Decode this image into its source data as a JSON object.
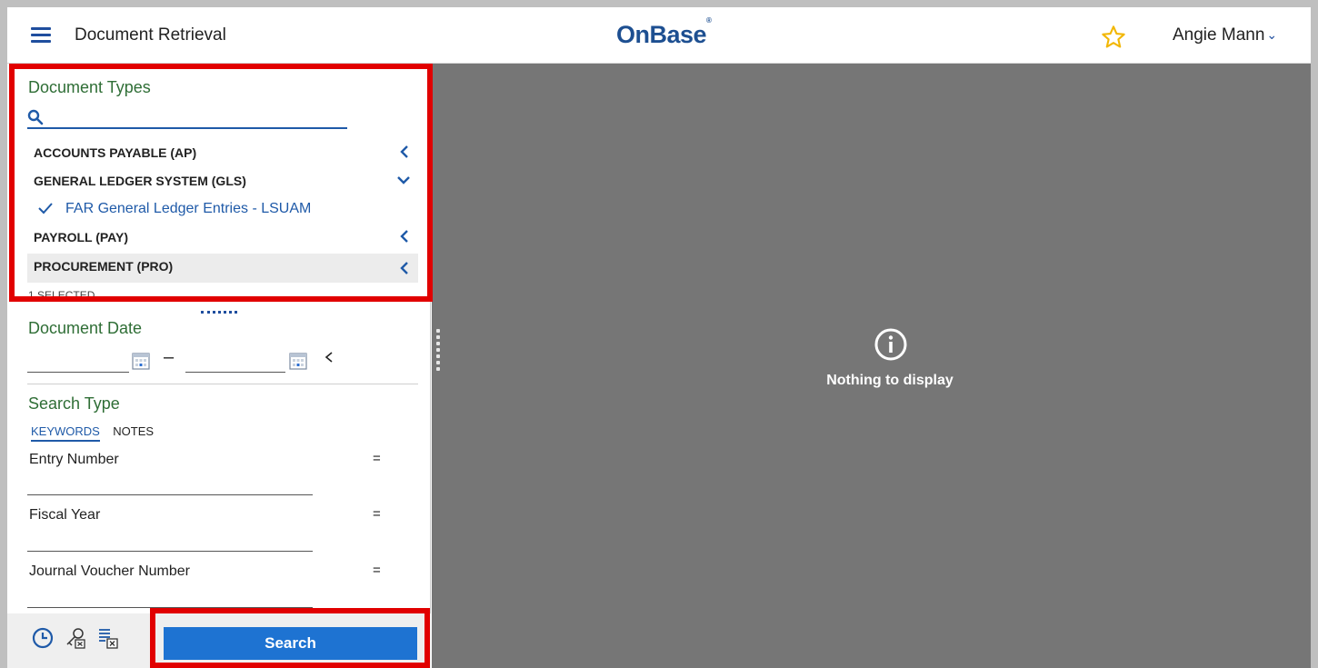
{
  "header": {
    "title": "Document Retrieval",
    "logo": "OnBase",
    "logo_mark": "®",
    "user_name": "Angie Mann"
  },
  "document_types": {
    "heading": "Document Types",
    "search_placeholder": "",
    "groups": [
      {
        "label": "ACCOUNTS PAYABLE (AP)",
        "state": "collapsed"
      },
      {
        "label": "GENERAL LEDGER SYSTEM (GLS)",
        "state": "expanded"
      },
      {
        "label": "PAYROLL (PAY)",
        "state": "collapsed"
      },
      {
        "label": "PROCUREMENT (PRO)",
        "state": "collapsed"
      }
    ],
    "selected_item": "FAR General Ledger Entries - LSUAM",
    "selected_count": "1 SELECTED"
  },
  "document_date": {
    "heading": "Document Date",
    "separator": "–",
    "from_value": "",
    "to_value": ""
  },
  "search_type": {
    "heading": "Search Type",
    "tabs": [
      "KEYWORDS",
      "NOTES"
    ],
    "active_tab": "KEYWORDS",
    "keywords": [
      {
        "label": "Entry Number",
        "operator": "=",
        "value": ""
      },
      {
        "label": "Fiscal Year",
        "operator": "=",
        "value": ""
      },
      {
        "label": "Journal Voucher Number",
        "operator": "=",
        "value": ""
      }
    ]
  },
  "actions": {
    "search_label": "Search",
    "icons": [
      "clock-icon",
      "keyword-clear-icon",
      "list-clear-icon"
    ]
  },
  "viewer": {
    "message": "Nothing to display",
    "icon": "info-icon"
  },
  "colors": {
    "brand_blue": "#1d4f91",
    "accent_blue": "#1e73d2",
    "heading_green": "#2f6e36",
    "viewer_gray": "#767676",
    "star_yellow": "#f2b705",
    "annotation_red": "#e10000"
  }
}
